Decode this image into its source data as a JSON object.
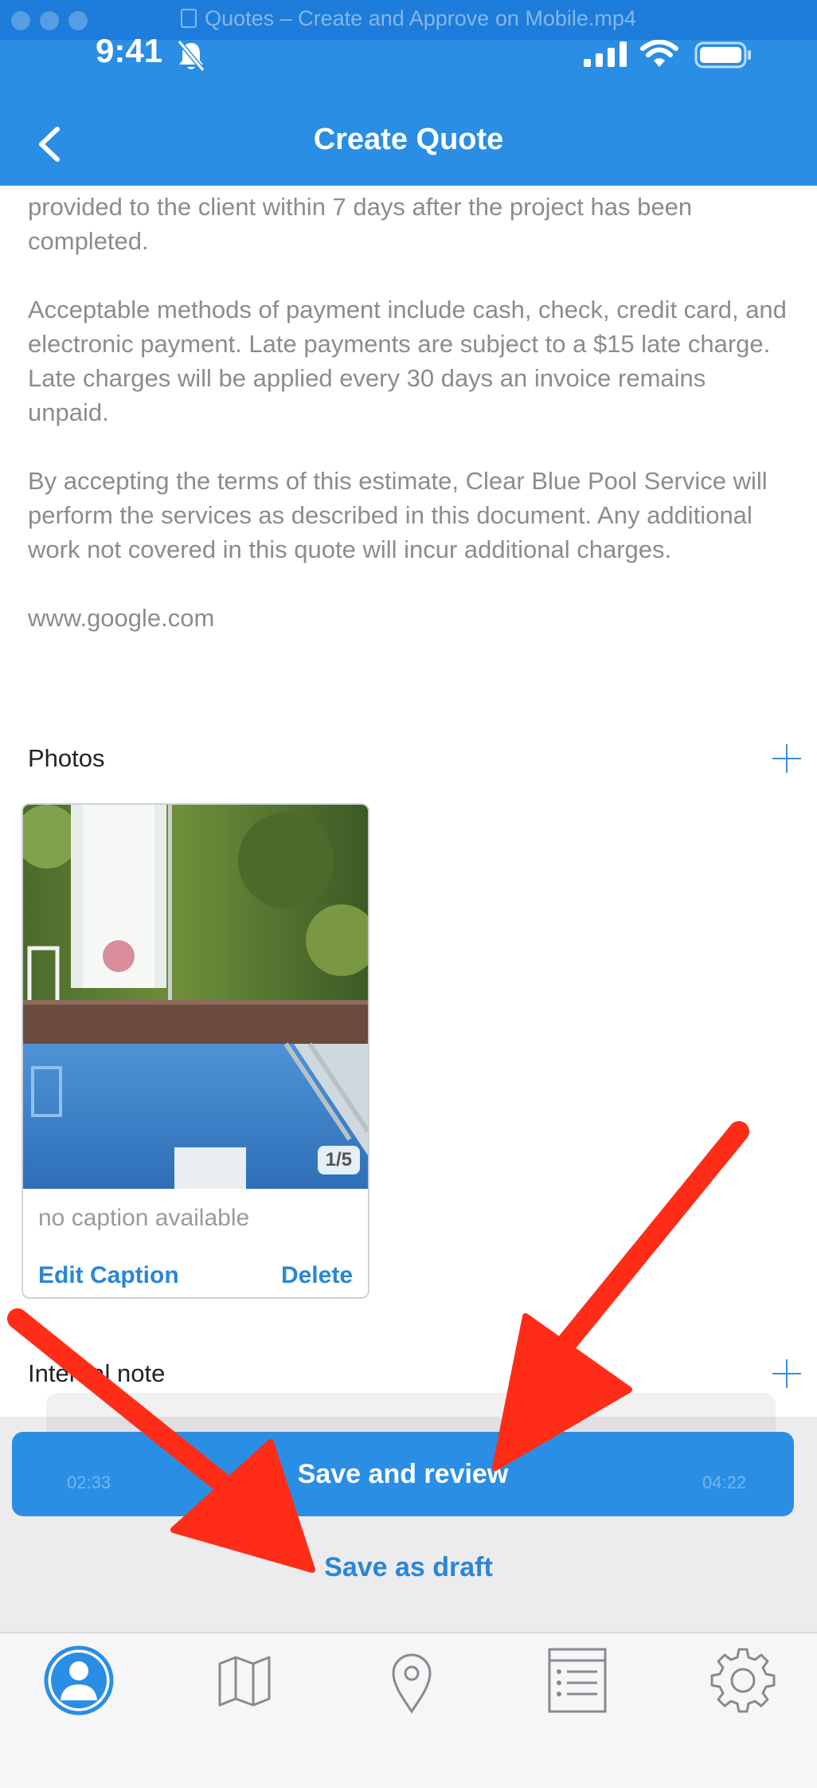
{
  "window": {
    "title": "Quotes – Create and Approve on Mobile.mp4"
  },
  "status_bar": {
    "time": "9:41"
  },
  "nav": {
    "title": "Create Quote"
  },
  "terms": {
    "paragraph_1": "provided to the client within 7 days after the project has been completed.",
    "paragraph_2": "Acceptable methods of payment include cash, check, credit card, and electronic payment. Late payments are subject to a $15 late charge. Late charges will be applied every 30 days an invoice remains unpaid.",
    "paragraph_3": "By accepting the terms of this estimate, Clear Blue Pool Service will perform the services as described in this document. Any additional work not covered in this quote will incur additional charges.",
    "link": "www.google.com"
  },
  "photos": {
    "label": "Photos",
    "counter": "1/5",
    "caption": "no caption available",
    "edit_caption_label": "Edit Caption",
    "delete_label": "Delete"
  },
  "internal_note": {
    "label": "Internal note"
  },
  "video_overlay": {
    "elapsed": "02:33",
    "remaining": "04:22"
  },
  "actions": {
    "save_review_label": "Save and review",
    "save_draft_label": "Save as draft"
  },
  "tabs": [
    {
      "icon": "profile-icon",
      "active": true
    },
    {
      "icon": "map-icon",
      "active": false
    },
    {
      "icon": "location-pin-icon",
      "active": false
    },
    {
      "icon": "list-icon",
      "active": false
    },
    {
      "icon": "settings-gear-icon",
      "active": false
    }
  ],
  "colors": {
    "header_blue": "#2a8ee4",
    "link_blue": "#2a86d6",
    "annotation_red": "#ff2d17",
    "body_text": "#8c8c8c"
  }
}
